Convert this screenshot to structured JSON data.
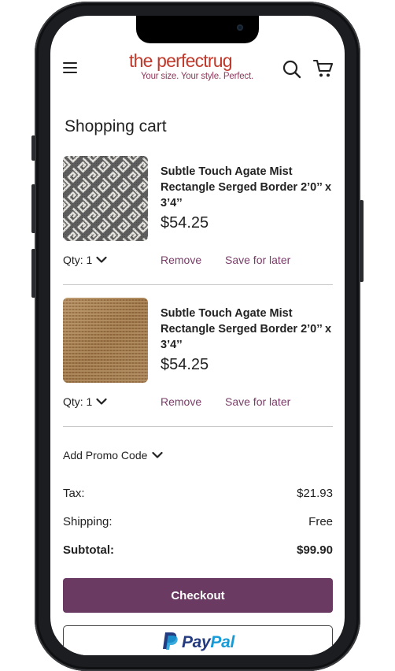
{
  "header": {
    "logo_main": "the perfect",
    "logo_rug": "rug",
    "logo_tagline": "Your size. Your style. Perfect.",
    "menu_icon": "hamburger-icon",
    "search_icon": "search-icon",
    "cart_icon": "cart-icon"
  },
  "page": {
    "title": "Shopping cart"
  },
  "items": [
    {
      "name": "Subtle Touch Agate Mist Rectangle Serged Border 2’0’’ x 3’4’’",
      "price": "$54.25",
      "qty_label": "Qty: 1",
      "remove_label": "Remove",
      "save_label": "Save for later",
      "swatch": "grey-geometric-weave"
    },
    {
      "name": "Subtle Touch Agate Mist Rectangle Serged Border 2’0’’ x 3’4’’",
      "price": "$54.25",
      "qty_label": "Qty: 1",
      "remove_label": "Remove",
      "save_label": "Save for later",
      "swatch": "tan-jute-weave"
    }
  ],
  "promo": {
    "label": "Add Promo Code"
  },
  "summary": {
    "tax_label": "Tax:",
    "tax_value": "$21.93",
    "shipping_label": "Shipping:",
    "shipping_value": "Free",
    "subtotal_label": "Subtotal:",
    "subtotal_value": "$99.90"
  },
  "actions": {
    "checkout_label": "Checkout",
    "paypal_pay": "Pay",
    "paypal_pal": "Pal"
  },
  "colors": {
    "brand_red": "#c0392b",
    "accent_plum": "#6b3a63",
    "link_plum": "#7a3b68",
    "paypal_dark": "#253b80",
    "paypal_light": "#179bd7"
  }
}
